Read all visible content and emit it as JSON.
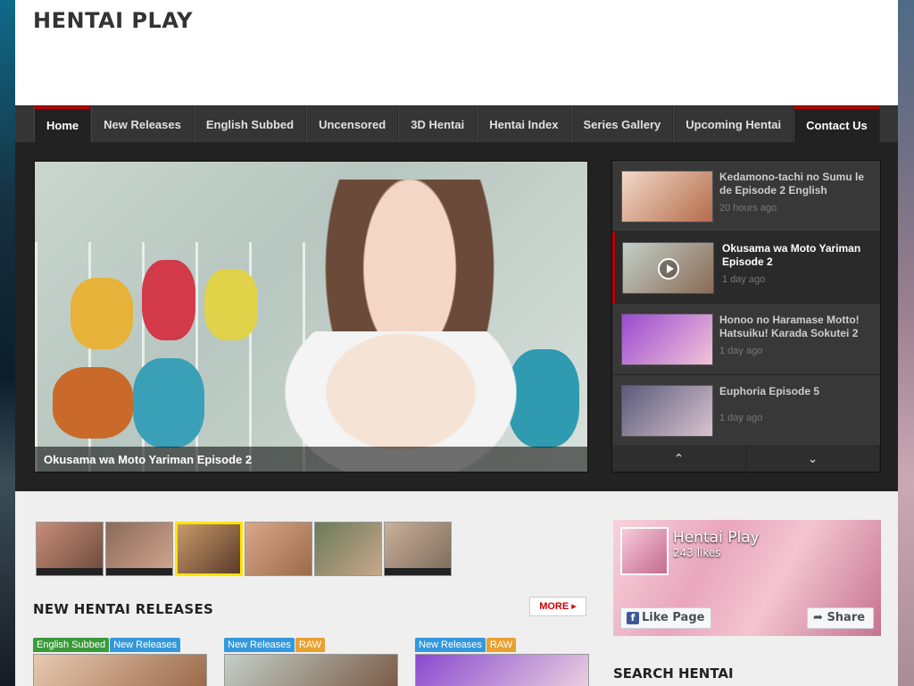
{
  "site": {
    "title": "HENTAI PLAY"
  },
  "nav": {
    "items": [
      {
        "label": "Home"
      },
      {
        "label": "New Releases"
      },
      {
        "label": "English Subbed"
      },
      {
        "label": "Uncensored"
      },
      {
        "label": "3D Hentai"
      },
      {
        "label": "Hentai Index"
      },
      {
        "label": "Series Gallery"
      },
      {
        "label": "Upcoming Hentai"
      },
      {
        "label": "Contact Us"
      }
    ]
  },
  "feature": {
    "caption": "Okusama wa Moto Yariman Episode 2",
    "list": [
      {
        "title": "Kedamono-tachi no Sumu le de Episode 2 English",
        "time": "20 hours ago"
      },
      {
        "title": "Okusama wa Moto Yariman Episode 2",
        "time": "1 day ago"
      },
      {
        "title": "Honoo no Haramase Motto! Hatsuiku! Karada Sokutei 2",
        "time": "1 day ago"
      },
      {
        "title": "Euphoria Episode 5",
        "time": "1 day ago"
      }
    ],
    "up_icon": "chevron-up-icon",
    "down_icon": "chevron-down-icon"
  },
  "releases": {
    "title": "NEW HENTAI RELEASES",
    "more_label": "MORE",
    "cards": [
      {
        "tags": [
          {
            "text": "English Subbed",
            "color": "green"
          },
          {
            "text": "New Releases",
            "color": "blue"
          }
        ]
      },
      {
        "tags": [
          {
            "text": "New Releases",
            "color": "blue"
          },
          {
            "text": "RAW",
            "color": "orange"
          }
        ]
      },
      {
        "tags": [
          {
            "text": "New Releases",
            "color": "blue"
          },
          {
            "text": "RAW",
            "color": "orange"
          }
        ]
      }
    ]
  },
  "facebook": {
    "page_name": "Hentai Play",
    "likes": "243 likes",
    "like_label": "Like Page",
    "share_label": "Share"
  },
  "search": {
    "title": "SEARCH HENTAI"
  },
  "colors": {
    "accent": "#bb0000",
    "nav_bg": "#353535",
    "feature_bg": "#222222"
  }
}
